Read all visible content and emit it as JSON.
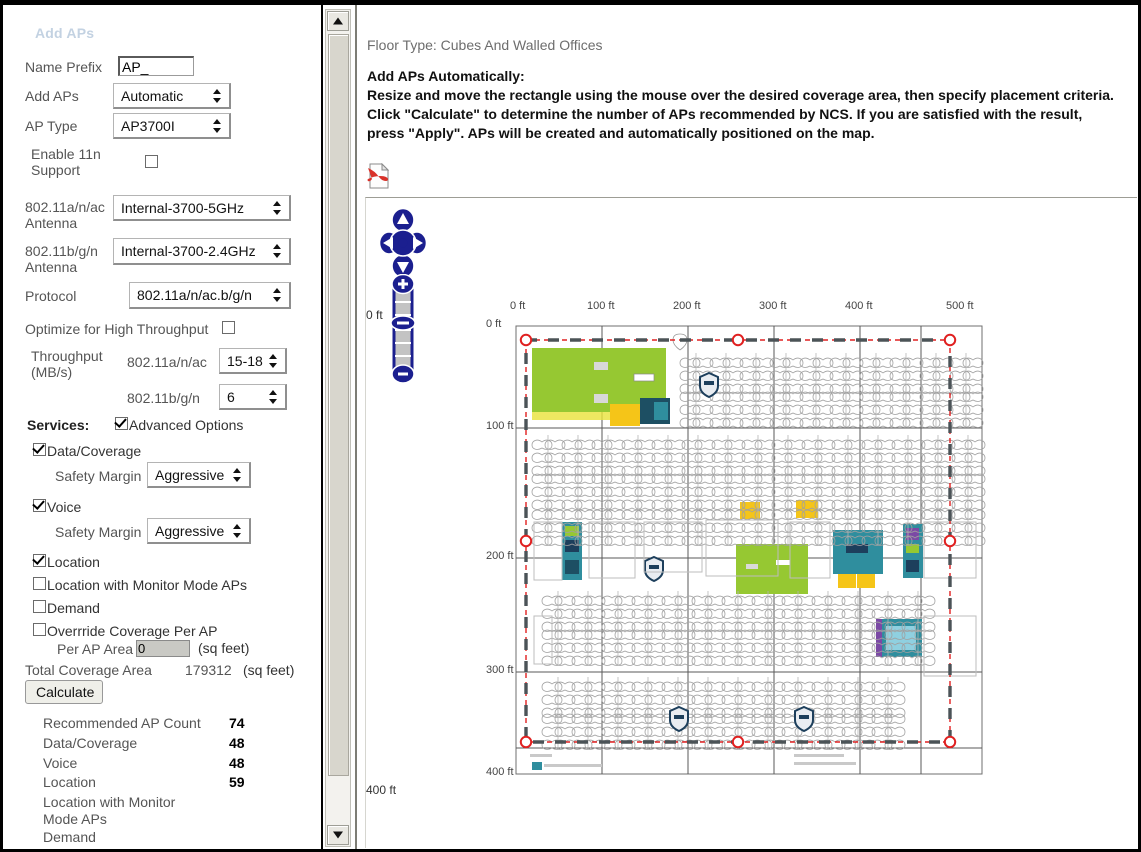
{
  "left_panel": {
    "title": "Add APs",
    "fields": {
      "name_prefix_label": "Name Prefix",
      "name_prefix_value": "AP_",
      "add_aps_label": "Add APs",
      "add_aps_value": "Automatic",
      "ap_type_label": "AP Type",
      "ap_type_value": "AP3700I",
      "enable_11n_label_line1": "Enable 11n",
      "enable_11n_label_line2": "Support",
      "enable_11n_checked": false,
      "ant_a_label_line1": "802.11a/n/ac",
      "ant_a_label_line2": "Antenna",
      "ant_a_value": "Internal-3700-5GHz",
      "ant_b_label_line1": "802.11b/g/n",
      "ant_b_label_line2": "Antenna",
      "ant_b_value": "Internal-3700-2.4GHz",
      "protocol_label": "Protocol",
      "protocol_value": "802.11a/n/ac.b/g/n",
      "optimize_label": "Optimize for High Throughput",
      "optimize_checked": false,
      "throughput_label_line1": "Throughput",
      "throughput_label_line2": "(MB/s)",
      "throughput_a_label": "802.11a/n/ac",
      "throughput_a_value": "15-18",
      "throughput_b_label": "802.11b/g/n",
      "throughput_b_value": "6"
    },
    "services": {
      "heading": "Services:",
      "advanced_options_label": "Advanced Options",
      "advanced_options_checked": true,
      "data_coverage_label": "Data/Coverage",
      "data_coverage_checked": true,
      "data_margin_label": "Safety Margin",
      "data_margin_value": "Aggressive",
      "voice_label": "Voice",
      "voice_checked": true,
      "voice_margin_label": "Safety Margin",
      "voice_margin_value": "Aggressive",
      "location_label": "Location",
      "location_checked": true,
      "location_monitor_label": "Location with Monitor Mode APs",
      "location_monitor_checked": false,
      "demand_label": "Demand",
      "demand_checked": false,
      "override_label": "Overrride Coverage Per AP",
      "override_checked": false,
      "per_ap_area_label": "Per AP Area",
      "per_ap_area_value": "0",
      "per_ap_area_units": "(sq feet)",
      "total_coverage_label": "Total Coverage Area",
      "total_coverage_value": "179312",
      "total_coverage_units": "(sq feet)",
      "calculate_button": "Calculate"
    },
    "results": [
      {
        "label": "Recommended AP Count",
        "value": "74"
      },
      {
        "label": "Data/Coverage",
        "value": "48"
      },
      {
        "label": "Voice",
        "value": "48"
      },
      {
        "label": "Location",
        "value": "59"
      },
      {
        "label": "Location with Monitor Mode APs",
        "value": ""
      },
      {
        "label": "Demand",
        "value": ""
      }
    ]
  },
  "right_panel": {
    "floor_type": "Floor Type: Cubes And Walled Offices",
    "instructions_heading": "Add APs Automatically:",
    "instructions_line1": "Resize and move the rectangle using the mouse over the desired coverage area, then specify placement criteria.",
    "instructions_line2": "Click \"Calculate\" to determine the number of APs recommended by NCS.  If  you are satisfied with the result,",
    "instructions_line3": "press \"Apply\". APs will be created and automatically positioned on the map.",
    "pdf_icon": "pdf-icon",
    "pan_control": "pan-control",
    "zoom_control": "zoom-slider"
  },
  "map": {
    "x_ticks": [
      "0 ft",
      "100 ft",
      "200 ft",
      "300 ft",
      "400 ft",
      "500 ft"
    ],
    "y_ticks": [
      "0 ft",
      "100 ft",
      "200 ft",
      "300 ft",
      "400 ft"
    ],
    "outer_x_origin": "0 ft",
    "outer_y_origin": "0 ft",
    "outer_y_end": "400 ft",
    "colors": {
      "selection_stroke": "#e02020",
      "selection_dash": "#4b5357",
      "highlight_green": "#96c832",
      "highlight_yellow": "#f5c518",
      "highlight_teal": "#2f8e9e",
      "grid": "#555555",
      "furniture": "#9a9a9a"
    }
  },
  "scrollbar": {
    "up_arrow": "scroll-up-icon",
    "down_arrow": "scroll-down-icon",
    "thumb": "scroll-thumb"
  }
}
